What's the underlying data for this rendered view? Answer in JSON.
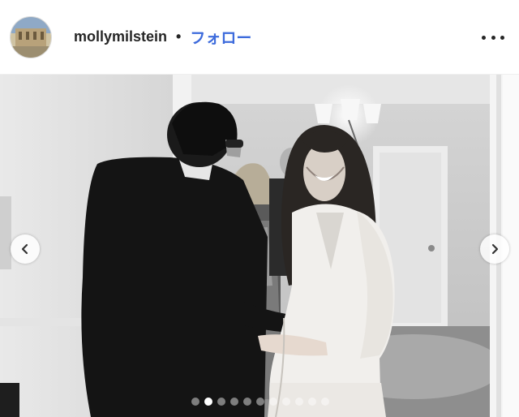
{
  "post_header": {
    "username": "mollymilstein",
    "separator": "•",
    "follow_label": "フォロー"
  },
  "icons": {
    "more": "more-options-icon",
    "prev": "chevron-left-icon",
    "next": "chevron-right-icon"
  },
  "carousel": {
    "total_slides": 11,
    "active_slide": 2
  },
  "colors": {
    "follow": "#3d6bdc",
    "text": "#262626"
  }
}
